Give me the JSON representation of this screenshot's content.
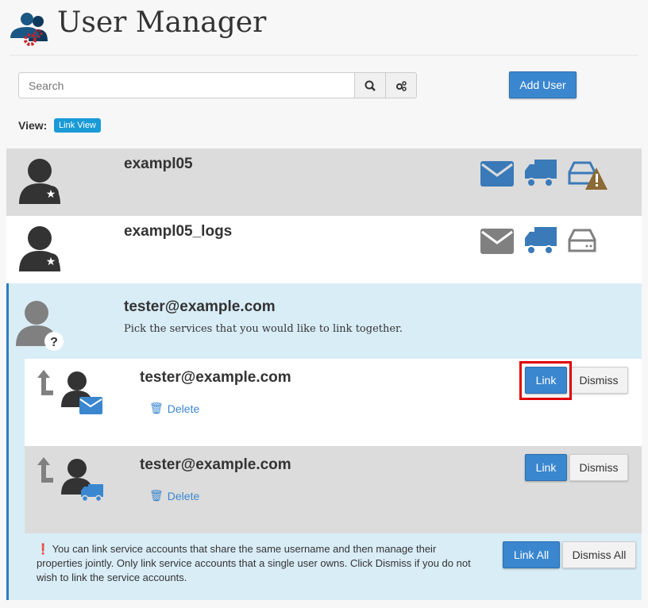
{
  "header": {
    "title": "User Manager",
    "logo_icon": "users-gear-icon"
  },
  "toolbar": {
    "search_placeholder": "Search",
    "add_user_label": "Add User"
  },
  "view": {
    "label": "View:",
    "value": "Link View"
  },
  "users": [
    {
      "name": "exampl05",
      "services": {
        "mail": "active",
        "shipping": "active",
        "storage": "warning"
      }
    },
    {
      "name": "exampl05_logs",
      "services": {
        "mail": "inactive",
        "shipping": "active",
        "storage": "inactive"
      }
    }
  ],
  "link_panel": {
    "name": "tester@example.com",
    "instruction": "Pick the services that you would like to link together.",
    "accounts": [
      {
        "name": "tester@example.com",
        "service": "mail",
        "delete_label": "Delete",
        "link_label": "Link",
        "dismiss_label": "Dismiss"
      },
      {
        "name": "tester@example.com",
        "service": "shipping",
        "delete_label": "Delete",
        "link_label": "Link",
        "dismiss_label": "Dismiss"
      }
    ],
    "note": "You can link service accounts that share the same username and then manage their properties jointly. Only link service accounts that a single user owns. Click Dismiss if you do not wish to link the service accounts.",
    "link_all_label": "Link All",
    "dismiss_all_label": "Dismiss All"
  },
  "colors": {
    "accent": "#3a87cf",
    "panel": "#d9edf7",
    "warning": "#8a6a35"
  }
}
